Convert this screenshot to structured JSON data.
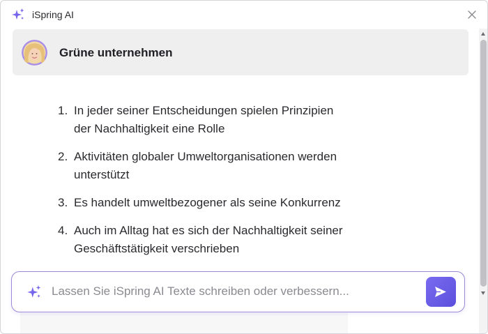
{
  "window": {
    "title": "iSpring AI",
    "icon": "sparkle-icon",
    "close_icon": "close-icon"
  },
  "topic": {
    "title": "Grüne unternehmen",
    "avatar": "user-avatar"
  },
  "answers": [
    {
      "number": "1.",
      "line1": "In jeder seiner Entscheidungen spielen Prinzipien",
      "line2": "der Nachhaltigkeit eine Rolle"
    },
    {
      "number": "2.",
      "line1": "Aktivitäten globaler Umweltorganisationen werden",
      "line2": "unterstützt"
    },
    {
      "number": "3.",
      "line1": "Es handelt umweltbezogener als seine Konkurrenz",
      "line2": ""
    },
    {
      "number": "4.",
      "line1": "Auch im Alltag hat es sich der Nachhaltigkeit seiner",
      "line2": "Geschäftstätigkeit verschrieben"
    }
  ],
  "prompt": {
    "placeholder": "Lassen Sie iSpring AI Texte schreiben oder verbessern...",
    "value": "",
    "icon": "sparkle-icon",
    "send_icon": "send-icon"
  },
  "colors": {
    "accent": "#6a5ce8",
    "accent_border": "#9b88d8",
    "card_bg": "#efeff0"
  }
}
